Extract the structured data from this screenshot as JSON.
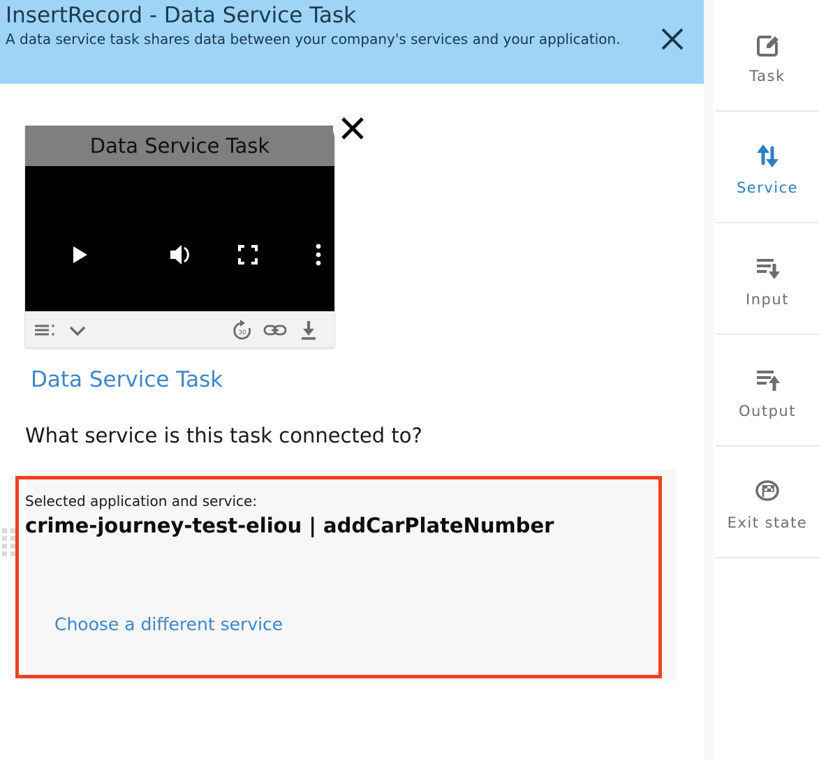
{
  "header": {
    "title": "InsertRecord - Data Service Task",
    "subtitle": "A data service task shares data between your company's services and your application.",
    "close_label": "×",
    "bg_color": "#9FD4F7",
    "text_color": "#1B3A52"
  },
  "video": {
    "title": "Data Service Task",
    "close_label": "×",
    "controls": {
      "play": "play-button",
      "volume": "volume-button",
      "fullscreen": "fullscreen-button",
      "more": "more-options-button",
      "progress_percent": 0
    },
    "toolbar": {
      "playlist": "playlist-icon",
      "chevron": "chevron-down-icon",
      "replay": "replay-30-icon",
      "replay_seconds": "30",
      "link": "copy-link-icon",
      "download": "download-icon"
    }
  },
  "content": {
    "link_title": "Data Service Task",
    "question": "What service is this task connected to?",
    "card": {
      "label": "Selected application and service:",
      "value": "crime-journey-test-eliou | addCarPlateNumber",
      "action": "Choose a different service"
    }
  },
  "annotation": {
    "color": "#EE4222"
  },
  "sidebar": {
    "items": [
      {
        "label": "Task",
        "icon": "task-edit-icon",
        "active": false
      },
      {
        "label": "Service",
        "icon": "service-arrows-icon",
        "active": true
      },
      {
        "label": "Input",
        "icon": "input-lines-down-icon",
        "active": false
      },
      {
        "label": "Output",
        "icon": "output-lines-up-icon",
        "active": false
      },
      {
        "label": "Exit state",
        "icon": "exit-state-flag-icon",
        "active": false
      }
    ],
    "active_color": "#2E7FC4",
    "inactive_color": "#6E6E6E"
  }
}
